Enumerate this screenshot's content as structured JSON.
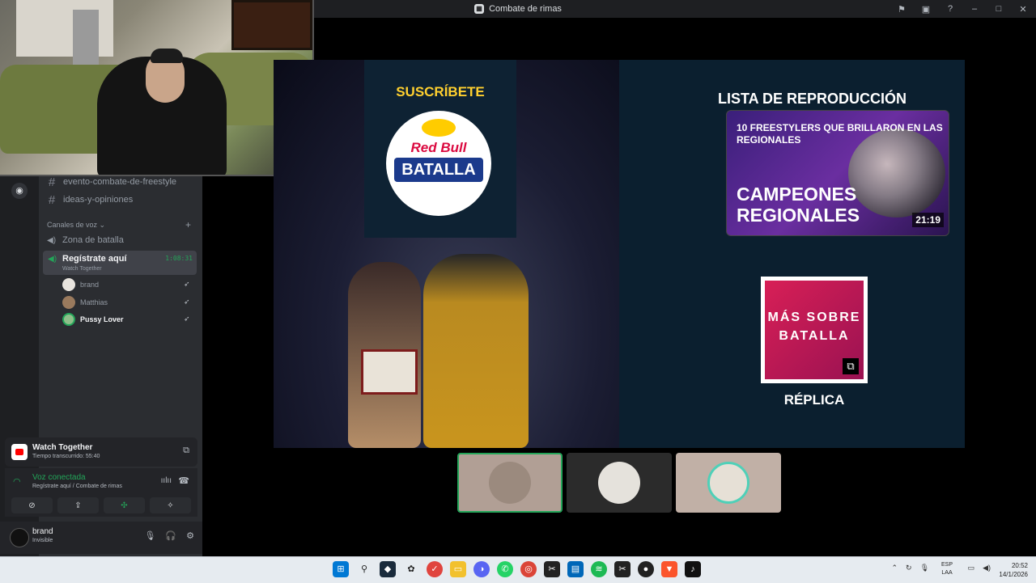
{
  "window": {
    "title": "Combate de rimas",
    "controls": [
      "⚑",
      "▣",
      "?",
      "–",
      "□",
      "✕"
    ]
  },
  "channels": {
    "text": [
      {
        "label": "evento-combate-de-freestyle"
      },
      {
        "label": "ideas-y-opiniones"
      }
    ],
    "voice_category": "Canales de voz",
    "voice": [
      {
        "label": "Zona de batalla"
      }
    ],
    "active_voice": {
      "label": "Regístrate aquí",
      "activity": "Watch Together",
      "timer": "1:08:31"
    },
    "members": [
      {
        "name": "brand",
        "color": "#949ba4"
      },
      {
        "name": "Matthias",
        "color": "#949ba4"
      },
      {
        "name": "Pussy Lover",
        "color": "#f2f3f5"
      }
    ]
  },
  "activity_panel": {
    "title": "Watch Together",
    "subtitle": "Tiempo transcurrido: 55:40"
  },
  "voice_panel": {
    "status": "Voz conectada",
    "channel": "Regístrate aquí / Combate de rimas"
  },
  "user": {
    "name": "brand",
    "status": "Invisible"
  },
  "video": {
    "subscribe": "SUSCRÍBETE",
    "logo_top": "Red Bull",
    "logo_main": "BATALLA",
    "playlist_label": "LISTA DE REPRODUCCIÓN",
    "thumb_title": "10 FREESTYLERS QUE BRILLARON EN LAS REGIONALES",
    "thumb_caption": "CAMPEONES REGIONALES",
    "thumb_duration": "21:19",
    "more_text": "MÁS SOBRE BATALLA",
    "replica": "RÉPLICA"
  },
  "taskbar": {
    "lang_1": "ESP",
    "lang_2": "LAA",
    "time": "20:52",
    "date": "14/1/2026"
  }
}
